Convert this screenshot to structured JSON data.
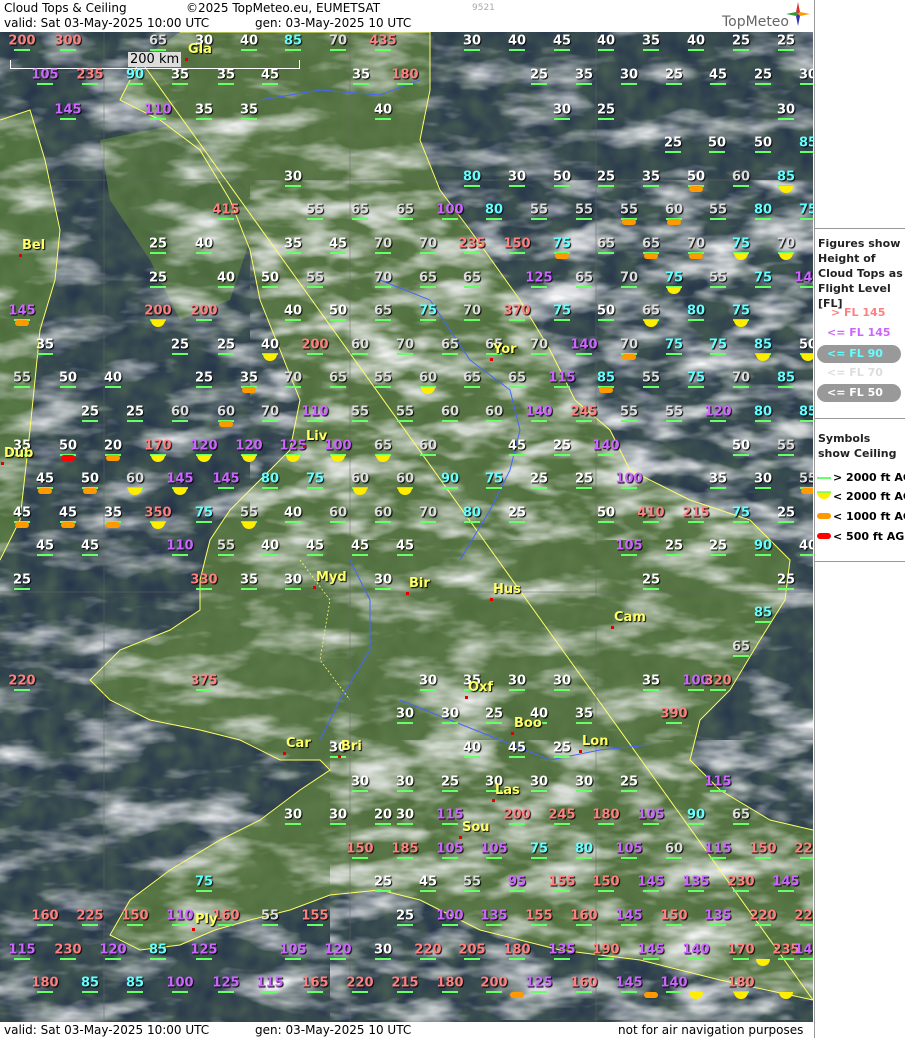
{
  "header": {
    "title": "Cloud Tops & Ceiling",
    "copyright": "©2025 TopMeteo.eu, EUMETSAT",
    "id": "9521",
    "valid": "valid:  Sat  03-May-2025  10:00 UTC",
    "gen": "gen: 03-May-2025 10 UTC",
    "brand": "TopMeteo"
  },
  "footer": {
    "valid": "valid:  Sat  03-May-2025  10:00 UTC",
    "gen": "gen: 03-May-2025 10 UTC",
    "disclaimer": "not for air navigation purposes"
  },
  "scale_label": "200 km",
  "legend": {
    "figures_title": "Figures show Height of Cloud Tops as Flight Level  [FL]",
    "levels": [
      {
        "label": "> FL 145",
        "color": "#ff8080"
      },
      {
        "label": "<= FL 145",
        "color": "#cc66ff"
      },
      {
        "label": "<= FL 90",
        "color": "#66ffff"
      },
      {
        "label": "<= FL 70",
        "color": "#dddddd"
      },
      {
        "label": "<= FL 50",
        "color": "#ffffff"
      }
    ],
    "symbols_title": "Symbols show Ceiling",
    "symbols": [
      {
        "label": "> 2000 ft AGL",
        "kind": "line",
        "color": "#66ff66"
      },
      {
        "label": "< 2000 ft AGL",
        "kind": "yellow",
        "color": "#ffee00"
      },
      {
        "label": "< 1000 ft AGL",
        "kind": "orange",
        "color": "#ff9900"
      },
      {
        "label": "< 500 ft AGL",
        "kind": "red",
        "color": "#ff0000"
      }
    ]
  },
  "cities": [
    {
      "name": "Gla"
    },
    {
      "name": "Bel"
    },
    {
      "name": "Yor"
    },
    {
      "name": "Liv"
    },
    {
      "name": "Myd"
    },
    {
      "name": "Bir"
    },
    {
      "name": "Hus"
    },
    {
      "name": "Cam"
    },
    {
      "name": "Oxf"
    },
    {
      "name": "Boo"
    },
    {
      "name": "Lon"
    },
    {
      "name": "Car"
    },
    {
      "name": "Bri"
    },
    {
      "name": "Las"
    },
    {
      "name": "Sou"
    },
    {
      "name": "Ply"
    },
    {
      "name": "Dub"
    }
  ],
  "cloud_tops": [
    [
      "200",
      "300",
      "65",
      "30",
      "40",
      "85",
      "70",
      "435",
      "30",
      "40",
      "45",
      "40",
      "35",
      "40",
      "25",
      "25"
    ],
    [
      "105",
      "235",
      "90",
      "35",
      "35",
      "45",
      "35",
      "180",
      "25",
      "35",
      "30",
      "25",
      "45",
      "25",
      "30"
    ],
    [
      "145",
      "110",
      "35",
      "35",
      "40",
      "30",
      "25",
      "30"
    ],
    [
      "25",
      "50",
      "50",
      "85"
    ],
    [
      "30",
      "80",
      "30",
      "50",
      "25",
      "35",
      "50",
      "60",
      "85"
    ],
    [
      "415",
      "55",
      "65",
      "65",
      "100",
      "80",
      "55",
      "55",
      "55",
      "60",
      "55",
      "80",
      "75"
    ],
    [
      "Bel",
      "25",
      "40",
      "35",
      "45",
      "70",
      "70",
      "235",
      "150",
      "75",
      "65",
      "65",
      "70",
      "75",
      "70"
    ],
    [
      "25",
      "40",
      "50",
      "55",
      "70",
      "65",
      "65",
      "125",
      "65",
      "70",
      "75",
      "55",
      "75",
      "140"
    ],
    [
      "145",
      "200",
      "200",
      "40",
      "50",
      "65",
      "75",
      "70",
      "370",
      "75",
      "50",
      "65",
      "80",
      "75"
    ],
    [
      "35",
      "25",
      "25",
      "40",
      "200",
      "60",
      "70",
      "65",
      "65",
      "70",
      "140",
      "70",
      "75",
      "75",
      "85",
      "50"
    ],
    [
      "55",
      "50",
      "40",
      "25",
      "35",
      "70",
      "65",
      "55",
      "60",
      "65",
      "65",
      "115",
      "85",
      "55",
      "75",
      "70",
      "85"
    ],
    [
      "25",
      "25",
      "60",
      "60",
      "70",
      "110",
      "55",
      "55",
      "60",
      "60",
      "140",
      "245",
      "55",
      "55",
      "120",
      "80",
      "85"
    ],
    [
      "35",
      "50",
      "20",
      "170",
      "120",
      "120",
      "125",
      "100",
      "65",
      "60",
      "45",
      "25",
      "140",
      "50",
      "55"
    ],
    [
      "45",
      "50",
      "60",
      "145",
      "145",
      "80",
      "75",
      "60",
      "60",
      "90",
      "75",
      "25",
      "25",
      "100",
      "35",
      "30",
      "55"
    ],
    [
      "45",
      "45",
      "35",
      "350",
      "75",
      "55",
      "40",
      "60",
      "60",
      "70",
      "80",
      "25",
      "50",
      "410",
      "215",
      "75",
      "25"
    ],
    [
      "45",
      "45",
      "110",
      "55",
      "40",
      "45",
      "45",
      "45",
      "105",
      "25",
      "25",
      "90",
      "40"
    ],
    [
      "25",
      "330",
      "35",
      "30",
      "30",
      "25",
      "25"
    ],
    [
      "85"
    ],
    [
      "65"
    ],
    [
      "220",
      "375",
      "30",
      "35",
      "30",
      "30",
      "35",
      "100",
      "320"
    ],
    [
      "30",
      "30",
      "25",
      "40",
      "35",
      "390"
    ],
    [
      "30",
      "40",
      "45",
      "25"
    ],
    [
      "30",
      "30",
      "25",
      "30",
      "30",
      "30",
      "25",
      "115"
    ],
    [
      "30",
      "30",
      "20",
      "30",
      "115",
      "200",
      "245",
      "180",
      "105",
      "90",
      "65"
    ],
    [
      "150",
      "185",
      "105",
      "105",
      "75",
      "80",
      "105",
      "60",
      "115",
      "150",
      "225"
    ],
    [
      "75",
      "25",
      "45",
      "55",
      "95",
      "155",
      "150",
      "145",
      "135",
      "230",
      "145"
    ],
    [
      "160",
      "225",
      "150",
      "110",
      "160",
      "55",
      "155",
      "25",
      "100",
      "135",
      "155",
      "160",
      "145",
      "150",
      "135",
      "220",
      "220"
    ],
    [
      "115",
      "230",
      "120",
      "85",
      "125",
      "105",
      "120",
      "30",
      "220",
      "205",
      "180",
      "135",
      "190",
      "145",
      "140",
      "170",
      "235",
      "145"
    ],
    [
      "180",
      "85",
      "85",
      "100",
      "125",
      "115",
      "165",
      "220",
      "215",
      "180",
      "200",
      "125",
      "160",
      "145",
      "140",
      "180"
    ]
  ]
}
